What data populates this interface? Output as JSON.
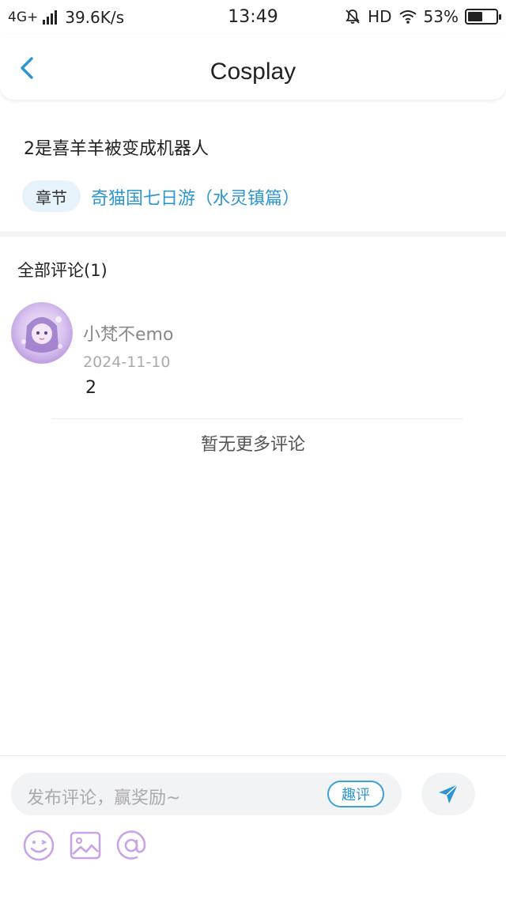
{
  "status_bar": {
    "network": "4G+",
    "speed": "39.6K/s",
    "time": "13:49",
    "hd": "HD",
    "battery_percent": "53%",
    "battery_level": 0.53
  },
  "header": {
    "title": "Cosplay"
  },
  "post": {
    "text": "2是喜羊羊被变成机器人",
    "chapter_tag": "章节",
    "chapter_title": "奇猫国七日游（水灵镇篇）"
  },
  "comments": {
    "title": "全部评论(1)",
    "items": [
      {
        "username": "小梵不emo",
        "date": "2024-11-10",
        "body": "2"
      }
    ],
    "no_more": "暂无更多评论"
  },
  "composer": {
    "placeholder": "发布评论，赢奖励~",
    "quping_label": "趣评"
  },
  "colors": {
    "accent": "#2e95d3",
    "tool_icon": "#c9a3e8",
    "tag_bg": "#e7f3fb"
  }
}
